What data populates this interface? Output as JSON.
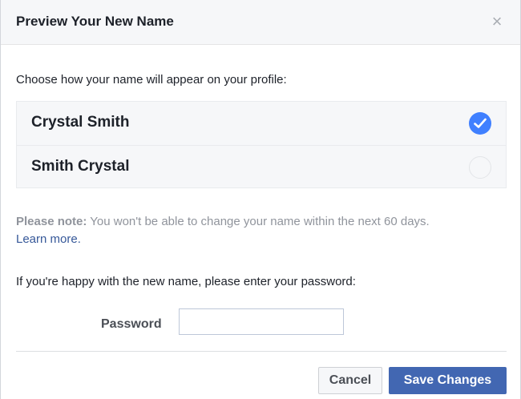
{
  "dialog": {
    "title": "Preview Your New Name",
    "close_icon": "×"
  },
  "instruction": "Choose how your name will appear on your profile:",
  "options": [
    {
      "label": "Crystal Smith",
      "selected": true
    },
    {
      "label": "Smith Crystal",
      "selected": false
    }
  ],
  "note": {
    "label": "Please note:",
    "text": " You won't be able to change your name within the next 60 days.",
    "link": "Learn more."
  },
  "password_prompt": "If you're happy with the new name, please enter your password:",
  "password": {
    "label": "Password",
    "value": ""
  },
  "buttons": {
    "cancel": "Cancel",
    "save": "Save Changes"
  },
  "colors": {
    "accent": "#4080ff",
    "primary_button": "#4267b2",
    "link": "#365899"
  }
}
